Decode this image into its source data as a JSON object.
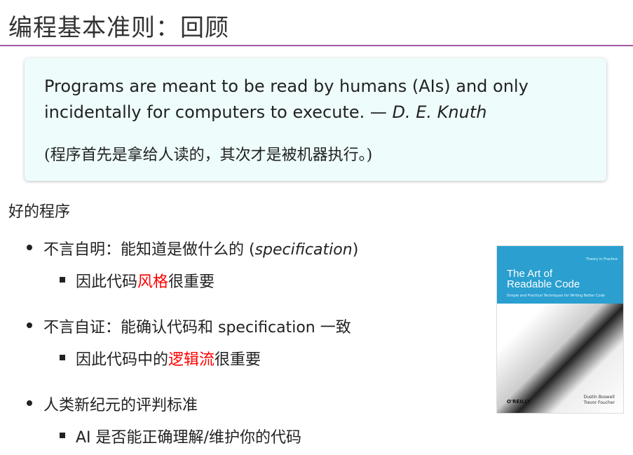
{
  "title": "编程基本准则：回顾",
  "quote": {
    "line1": "Programs are meant to be read by humans (AIs) and only",
    "line2_text": "incidentally for computers to execute. — ",
    "line2_author": "D. E. Knuth",
    "line3": "(程序首先是拿给人读的，其次才是被机器执行。)"
  },
  "heading": "好的程序",
  "bullets": [
    {
      "pre": "不言自明：能知道是做什么的 (",
      "em": "specification",
      "post": ")",
      "sub": {
        "pre": "因此代码",
        "red": "风格",
        "post": "很重要"
      }
    },
    {
      "pre": "不言自证：能确认代码和 specification 一致",
      "sub": {
        "pre": "因此代码中的",
        "red": "逻辑流",
        "post": "很重要"
      }
    },
    {
      "pre": "人类新纪元的评判标准",
      "sub": {
        "pre": "AI 是否能正确理解/维护你的代码"
      }
    }
  ],
  "book": {
    "tag": "Theory in Practice",
    "title1": "The Art of",
    "title2": "Readable Code",
    "subtitle": "Simple and Practical Techniques for Writing Better Code",
    "author1": "Dustin Boswell",
    "author2": "Trevor Foucher",
    "publisher": "O'REILLY"
  },
  "colors": {
    "accent_rule": "#a45aa0",
    "highlight": "#ff0000",
    "quote_bg": "#eefcfc"
  }
}
